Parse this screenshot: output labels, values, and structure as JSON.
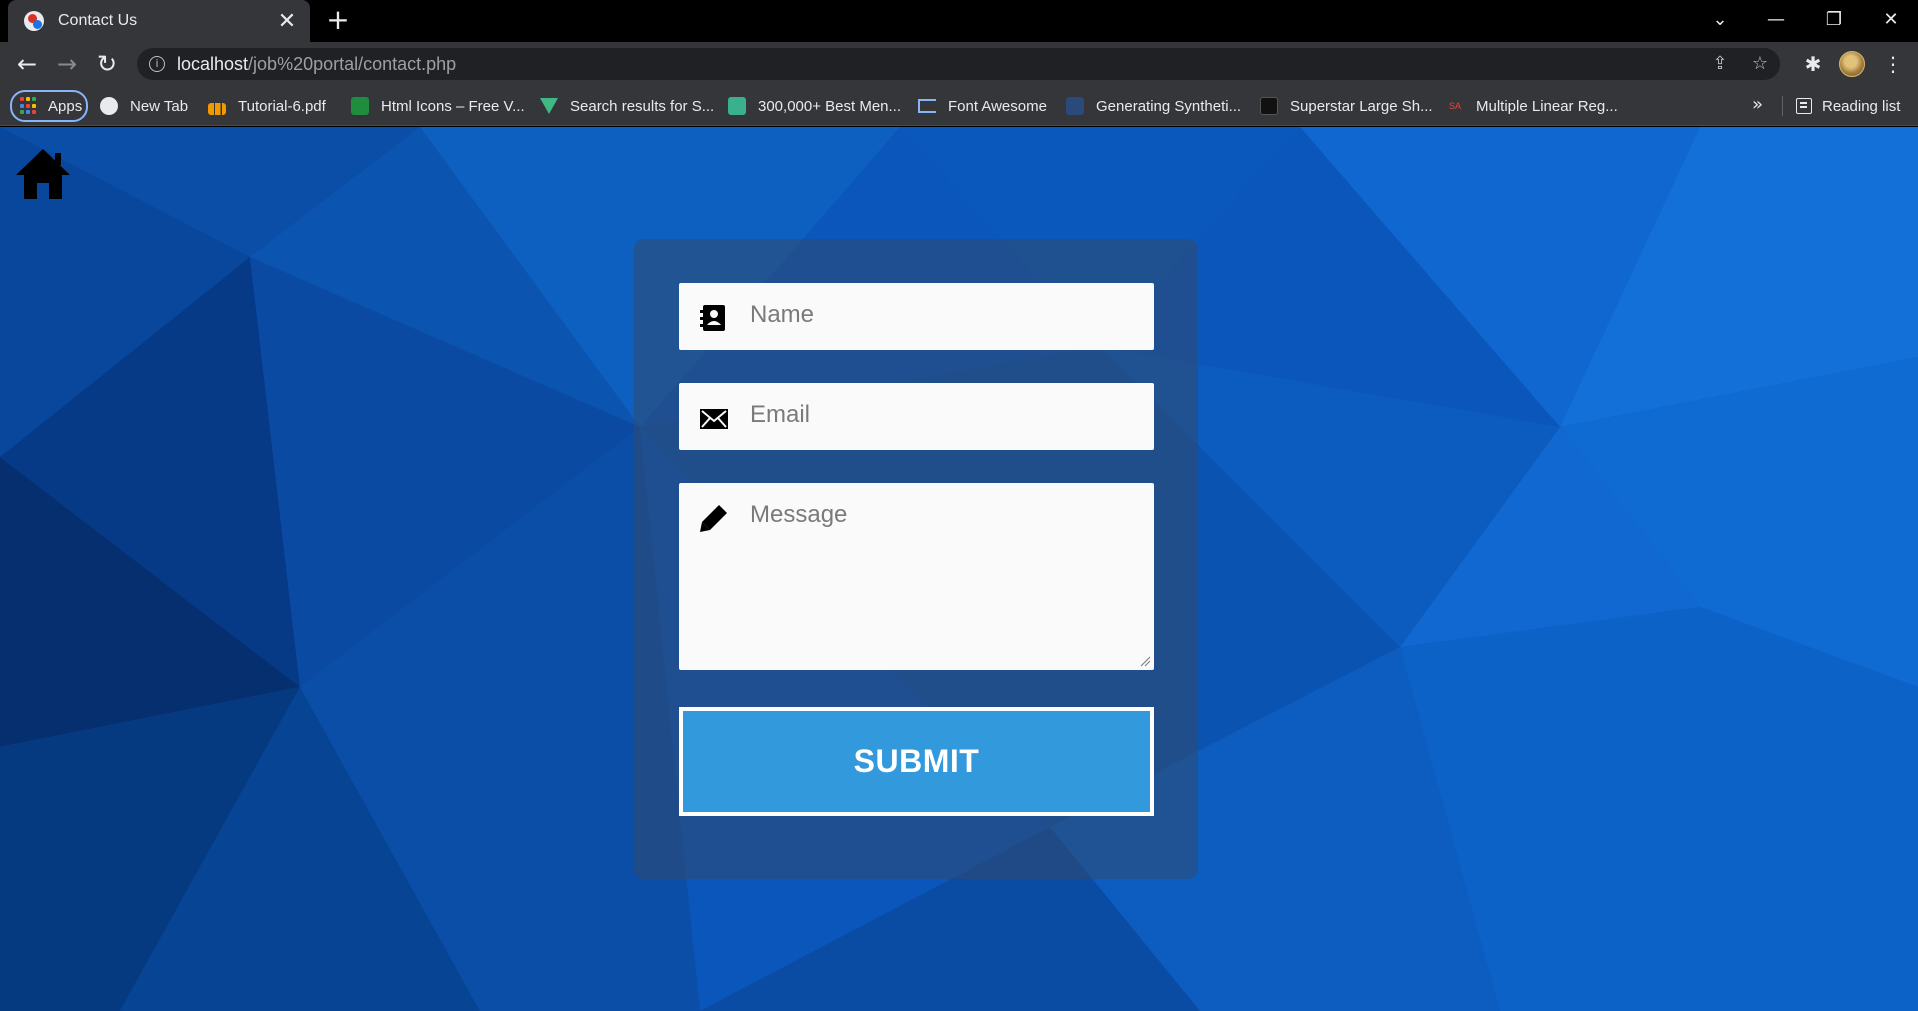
{
  "browser": {
    "tab": {
      "title": "Contact Us",
      "close": "✕"
    },
    "new_tab": "+",
    "window_controls": {
      "dropdown": "⌄",
      "minimize": "—",
      "restore": "❐",
      "close": "✕"
    },
    "nav": {
      "back": "←",
      "forward": "→",
      "reload": "↻"
    },
    "address": {
      "host": "localhost",
      "path": "/job%20portal/contact.php",
      "info": "i"
    },
    "omnibox_icons": {
      "share": "⇪",
      "star": "☆"
    },
    "toolbar_icons": {
      "extensions": "✱",
      "menu": "⋮"
    },
    "bookmarks": [
      {
        "label": "Apps",
        "icon": "apps-icon"
      },
      {
        "label": "New Tab",
        "icon": "globe-icon"
      },
      {
        "label": "Tutorial-6.pdf",
        "icon": "pdf-icon"
      },
      {
        "label": "Html Icons – Free V...",
        "icon": "green-square-icon"
      },
      {
        "label": "Search results for S...",
        "icon": "v-icon"
      },
      {
        "label": "300,000+ Best Men...",
        "icon": "teal-icon"
      },
      {
        "label": "Font Awesome",
        "icon": "flag-icon"
      },
      {
        "label": "Generating Syntheti...",
        "icon": "tds-icon"
      },
      {
        "label": "Superstar Large Sh...",
        "icon": "dark-icon"
      },
      {
        "label": "Multiple Linear Reg...",
        "icon": "sa-icon"
      }
    ],
    "bookmarks_more": "»",
    "reading_list": "Reading list"
  },
  "page": {
    "colors": {
      "background": "#0a55b8",
      "submit": "#3399dd",
      "panel": "#324b6e"
    },
    "form": {
      "name_placeholder": "Name",
      "email_placeholder": "Email",
      "message_placeholder": "Message",
      "submit_label": "SUBMIT"
    }
  }
}
